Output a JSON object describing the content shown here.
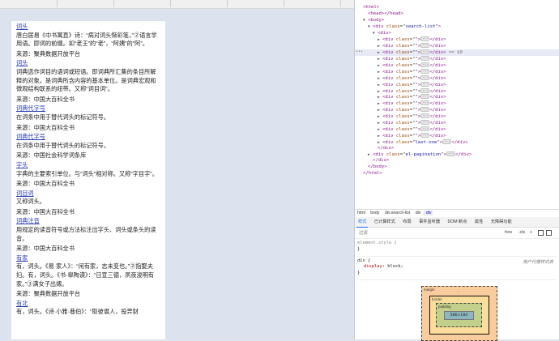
{
  "search_results": [
    {
      "term": "词头",
      "lines": [
        "唐白居易《中书寓直》诗：“病对词头惭彩笔，”②语言学用语。即词的前缀。如“老王”的“老”，“阿姨”的“阿”。"
      ],
      "source": "来源：聚典数据开放平台"
    },
    {
      "term": "词头",
      "lines": [
        "词典选作词目的语词或短语。即词典所汇集的条目所解释的对象。是词典所含内容的基本单位。是词典宏观和微观结构联系的纽带。又称“词目词”。"
      ],
      "source": "来源：中国大百科全书"
    },
    {
      "term": "词典代字号",
      "lines": [
        "在词条中用于替代词头的标记符号。"
      ],
      "source": "来源：中国大百科全书"
    },
    {
      "term": "词典代字号",
      "lines": [
        "在词条中用于替代词头的标记符号。"
      ],
      "source": "来源：中国社会科学词条库"
    },
    {
      "term": "字头",
      "lines": [
        "字典的主要索引单位。与“词头”相对称。又称“字目字”。"
      ],
      "source": "来源：中国大百科全书"
    },
    {
      "term": "词目词",
      "lines": [
        "又称词头。"
      ],
      "source": "来源：中国大百科全书"
    },
    {
      "term": "词典注音",
      "lines": [
        "用规定的读音符号或方法标注出字头、词头或条头的读音。"
      ],
      "source": "来源：中国大百科全书"
    },
    {
      "term": "有家",
      "lines": [
        "有，词头。《易·家人》：“闲有家，志未变也。”②指娶夫妇。有，词头。《书·皋陶谟》：“日宣三德，夙夜浚明有家。”③满女子出嫁。"
      ],
      "source": "来源：聚典数据开放平台"
    },
    {
      "term": "有北",
      "lines": [
        "有，词头。《诗·小雅·巷伯》：“取彼谮人，投畀豺"
      ],
      "source": ""
    }
  ],
  "dom_tree": [
    {
      "indent": 0,
      "tri": "",
      "open": "html",
      "attr": "",
      "val": "",
      "ell": false,
      "close": ""
    },
    {
      "indent": 1,
      "tri": "",
      "open": "head",
      "attr": "",
      "val": "",
      "ell": false,
      "close": "</head>"
    },
    {
      "indent": 1,
      "tri": "▼",
      "open": "body",
      "attr": "",
      "val": "",
      "ell": false,
      "close": ""
    },
    {
      "indent": 2,
      "tri": "▼",
      "open": "div",
      "attr": "class",
      "val": "search-list",
      "ell": false,
      "close": ""
    },
    {
      "indent": 3,
      "tri": "▼",
      "open": "div",
      "attr": "",
      "val": "",
      "ell": false,
      "close": ""
    },
    {
      "indent": 4,
      "tri": "▶",
      "open": "div",
      "attr": "class",
      "val": "",
      "ell": true,
      "close": "</div>"
    },
    {
      "indent": 4,
      "tri": "▶",
      "open": "div",
      "attr": "class",
      "val": "",
      "ell": true,
      "close": "</div>"
    },
    {
      "indent": 4,
      "tri": "▶",
      "open": "div",
      "attr": "class",
      "val": "",
      "ell": true,
      "close": "</div>",
      "selected": true,
      "eq": "== $0"
    },
    {
      "indent": 4,
      "tri": "▶",
      "open": "div",
      "attr": "class",
      "val": "",
      "ell": true,
      "close": "</div>"
    },
    {
      "indent": 4,
      "tri": "▶",
      "open": "div",
      "attr": "class",
      "val": "",
      "ell": true,
      "close": "</div>"
    },
    {
      "indent": 4,
      "tri": "▶",
      "open": "div",
      "attr": "class",
      "val": "",
      "ell": true,
      "close": "</div>"
    },
    {
      "indent": 4,
      "tri": "▶",
      "open": "div",
      "attr": "class",
      "val": "",
      "ell": true,
      "close": "</div>"
    },
    {
      "indent": 4,
      "tri": "▶",
      "open": "div",
      "attr": "class",
      "val": "",
      "ell": true,
      "close": "</div>"
    },
    {
      "indent": 4,
      "tri": "▶",
      "open": "div",
      "attr": "class",
      "val": "",
      "ell": true,
      "close": "</div>"
    },
    {
      "indent": 4,
      "tri": "▶",
      "open": "div",
      "attr": "class",
      "val": "",
      "ell": true,
      "close": "</div>"
    },
    {
      "indent": 4,
      "tri": "▶",
      "open": "div",
      "attr": "class",
      "val": "",
      "ell": true,
      "close": "</div>"
    },
    {
      "indent": 4,
      "tri": "▶",
      "open": "div",
      "attr": "class",
      "val": "",
      "ell": true,
      "close": "</div>"
    },
    {
      "indent": 4,
      "tri": "▶",
      "open": "div",
      "attr": "class",
      "val": "",
      "ell": true,
      "close": "</div>"
    },
    {
      "indent": 4,
      "tri": "▶",
      "open": "div",
      "attr": "class",
      "val": "",
      "ell": true,
      "close": "</div>"
    },
    {
      "indent": 4,
      "tri": "▶",
      "open": "div",
      "attr": "class",
      "val": "",
      "ell": true,
      "close": "</div>"
    },
    {
      "indent": 4,
      "tri": "▶",
      "open": "div",
      "attr": "class",
      "val": "",
      "ell": true,
      "close": "</div>"
    },
    {
      "indent": 4,
      "tri": "▶",
      "open": "div",
      "attr": "class",
      "val": "last-one",
      "ell": true,
      "close": "</div>"
    },
    {
      "indent": 3,
      "tri": "",
      "open": "",
      "attr": "",
      "val": "",
      "ell": false,
      "close": "</div>"
    },
    {
      "indent": 2,
      "tri": "▶",
      "open": "div",
      "attr": "class",
      "val": "el-pagination",
      "ell": true,
      "close": "</div>"
    },
    {
      "indent": 2,
      "tri": "",
      "open": "",
      "attr": "",
      "val": "",
      "ell": false,
      "close": "</div>"
    },
    {
      "indent": 1,
      "tri": "",
      "open": "",
      "attr": "",
      "val": "",
      "ell": false,
      "close": "</body>"
    },
    {
      "indent": 0,
      "tri": "",
      "open": "",
      "attr": "",
      "val": "",
      "ell": false,
      "close": "</html>"
    }
  ],
  "breadcrumbs": [
    "html",
    "body",
    "div.search-list",
    "div",
    "div"
  ],
  "styles_tabs": [
    "样式",
    "已计算样式",
    "布局",
    "事件监听器",
    "DOM 断点",
    "属性",
    "无障碍功能"
  ],
  "filter": {
    "placeholder": "过滤",
    "hov": ":hov",
    "cls": ".cls",
    "plus": "+"
  },
  "rules": {
    "element_style_selector": "element.style {",
    "element_style_close": "}",
    "div_selector": "div {",
    "div_source": "用户代理样式表",
    "div_prop": "display",
    "div_value": "block;",
    "div_close": "}"
  },
  "box_model": {
    "margin": "margin",
    "margin_value": "-",
    "border": "border",
    "border_value": "-",
    "padding": "padding",
    "padding_value": "-",
    "content": "586×184"
  },
  "colors": {
    "link": "#2c40b8",
    "selection": "#e8eaf6",
    "tag": "#8a1a8a"
  }
}
